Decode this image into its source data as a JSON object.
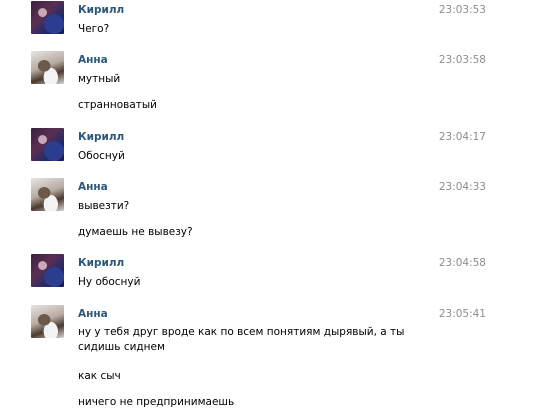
{
  "messages": [
    {
      "sender": "Кирилл",
      "avatar": "kirill-avatar",
      "time": "23:03:53",
      "lines": [
        "Чего?"
      ]
    },
    {
      "sender": "Анна",
      "avatar": "anna-avatar",
      "time": "23:03:58",
      "lines": [
        "мутный",
        "странноватый"
      ]
    },
    {
      "sender": "Кирилл",
      "avatar": "kirill-avatar",
      "time": "23:04:17",
      "lines": [
        "Обоснуй"
      ]
    },
    {
      "sender": "Анна",
      "avatar": "anna-avatar",
      "time": "23:04:33",
      "lines": [
        "вывезти?",
        "думаешь не вывезу?"
      ]
    },
    {
      "sender": "Кирилл",
      "avatar": "kirill-avatar",
      "time": "23:04:58",
      "lines": [
        "Ну обоснуй"
      ]
    },
    {
      "sender": "Анна",
      "avatar": "anna-avatar",
      "time": "23:05:41",
      "lines": [
        "ну у тебя друг вроде как по всем понятиям дырявый, а ты сидишь сиднем",
        "как сыч",
        "ничего не предпринимаешь"
      ]
    }
  ],
  "colors": {
    "sender_name": "#2b587a",
    "timestamp": "#8d8d8d",
    "message_text": "#000000",
    "background": "#ffffff"
  }
}
